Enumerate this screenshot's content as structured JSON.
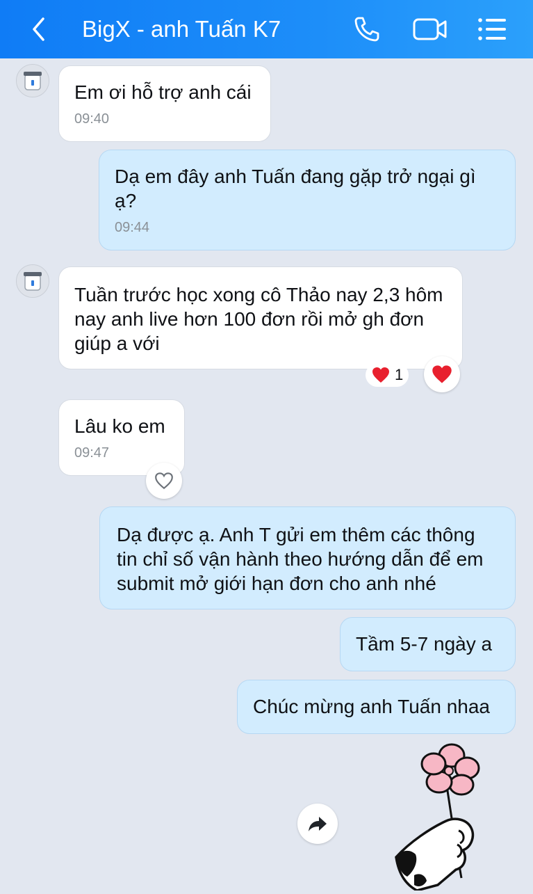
{
  "header": {
    "title": "BigX - anh Tuấn K7",
    "back_icon": "chevron-left-icon",
    "call_icon": "phone-icon",
    "video_icon": "video-camera-icon",
    "menu_icon": "list-menu-icon"
  },
  "messages": [
    {
      "text": "Em ơi hỗ trợ anh cái",
      "time": "09:40"
    },
    {
      "text": "Dạ em đây anh Tuấn đang gặp trở ngại gì ạ?",
      "time": "09:44"
    },
    {
      "text": "Tuần trước học xong cô Thảo nay 2,3 hôm nay anh live hơn 100 đơn rồi mở gh đơn giúp a với",
      "reaction_count": "1"
    },
    {
      "text": "Lâu ko em",
      "time": "09:47"
    },
    {
      "text": "Dạ được ạ. Anh T gửi em thêm các thông tin chỉ số vận hành theo hướng dẫn để em submit mở giới hạn đơn cho anh nhé"
    },
    {
      "text": "Tầm 5-7 ngày a"
    },
    {
      "text": "Chúc mừng anh Tuấn nhaa"
    }
  ],
  "colors": {
    "header": "#1a8af8",
    "background": "#e2e7f0",
    "incoming_bubble": "#ffffff",
    "outgoing_bubble": "#d2ecfe",
    "heart": "#e8202e"
  }
}
